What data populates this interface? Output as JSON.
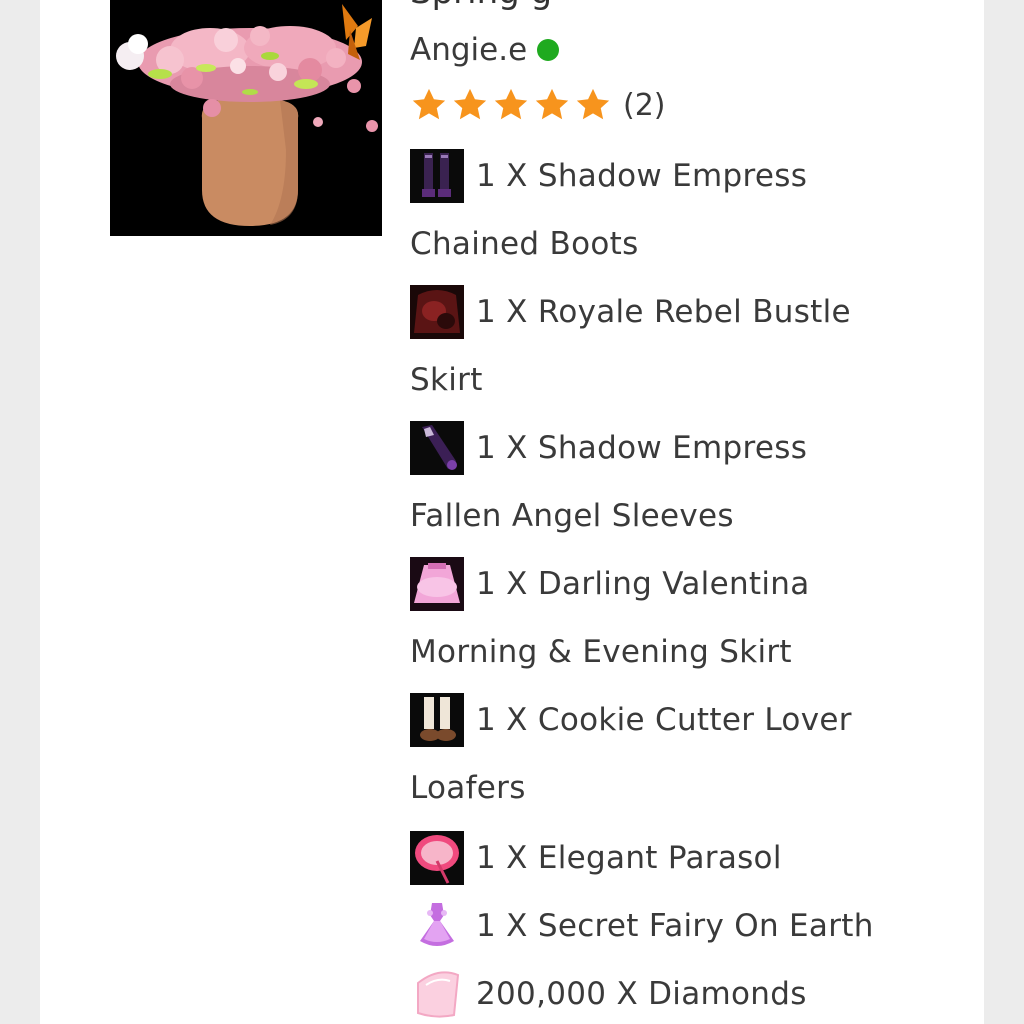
{
  "listing": {
    "title_partial": "Spring g",
    "seller_name": "Angie.e",
    "rating": {
      "stars": 5,
      "max_stars": 5,
      "review_count": "(2)"
    },
    "status_colors": {
      "online": "#1faa1f",
      "star": "#f7941d"
    },
    "items": [
      {
        "icon": "dark-boots-icon",
        "line1": "1 X Shadow Empress",
        "line2": "Chained Boots"
      },
      {
        "icon": "bustle-skirt-icon",
        "line1": "1 X Royale Rebel Bustle",
        "line2": "Skirt"
      },
      {
        "icon": "dark-sleeves-icon",
        "line1": "1 X Shadow Empress",
        "line2": "Fallen Angel Sleeves"
      },
      {
        "icon": "pink-skirt-icon",
        "line1": "1 X Darling Valentina",
        "line2": "Morning & Evening Skirt"
      },
      {
        "icon": "loafers-icon",
        "line1": "1 X Cookie Cutter Lover",
        "line2": "Loafers"
      },
      {
        "icon": "parasol-icon",
        "line1": "1 X Elegant Parasol",
        "line2": ""
      },
      {
        "icon": "fairy-dress-icon",
        "line1": "1 X Secret Fairy On Earth",
        "line2": ""
      },
      {
        "icon": "diamond-icon",
        "line1": "200,000 X Diamonds",
        "line2": ""
      }
    ]
  }
}
